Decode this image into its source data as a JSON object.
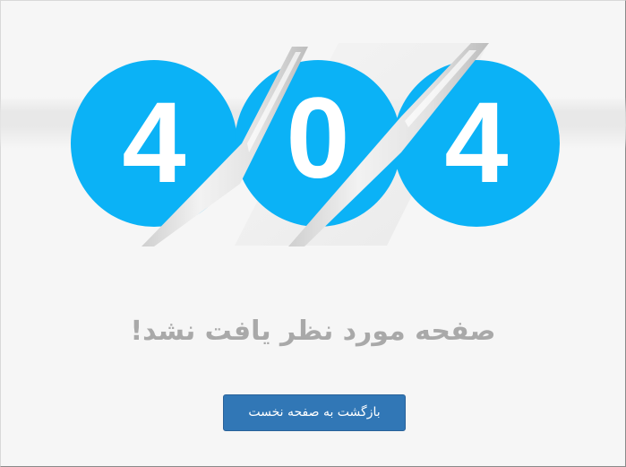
{
  "error": {
    "digits": [
      "4",
      "0",
      "4"
    ],
    "message": "صفحه مورد نظر یافت نشد!"
  },
  "actions": {
    "home_button_label": "بازگشت به صفحه نخست"
  },
  "colors": {
    "background": "#f6f6f6",
    "circle": "#0bb2f6",
    "digit": "#ffffff",
    "message_text": "#a9a9a9",
    "button": "#3177b6",
    "button_text": "#ffffff"
  }
}
